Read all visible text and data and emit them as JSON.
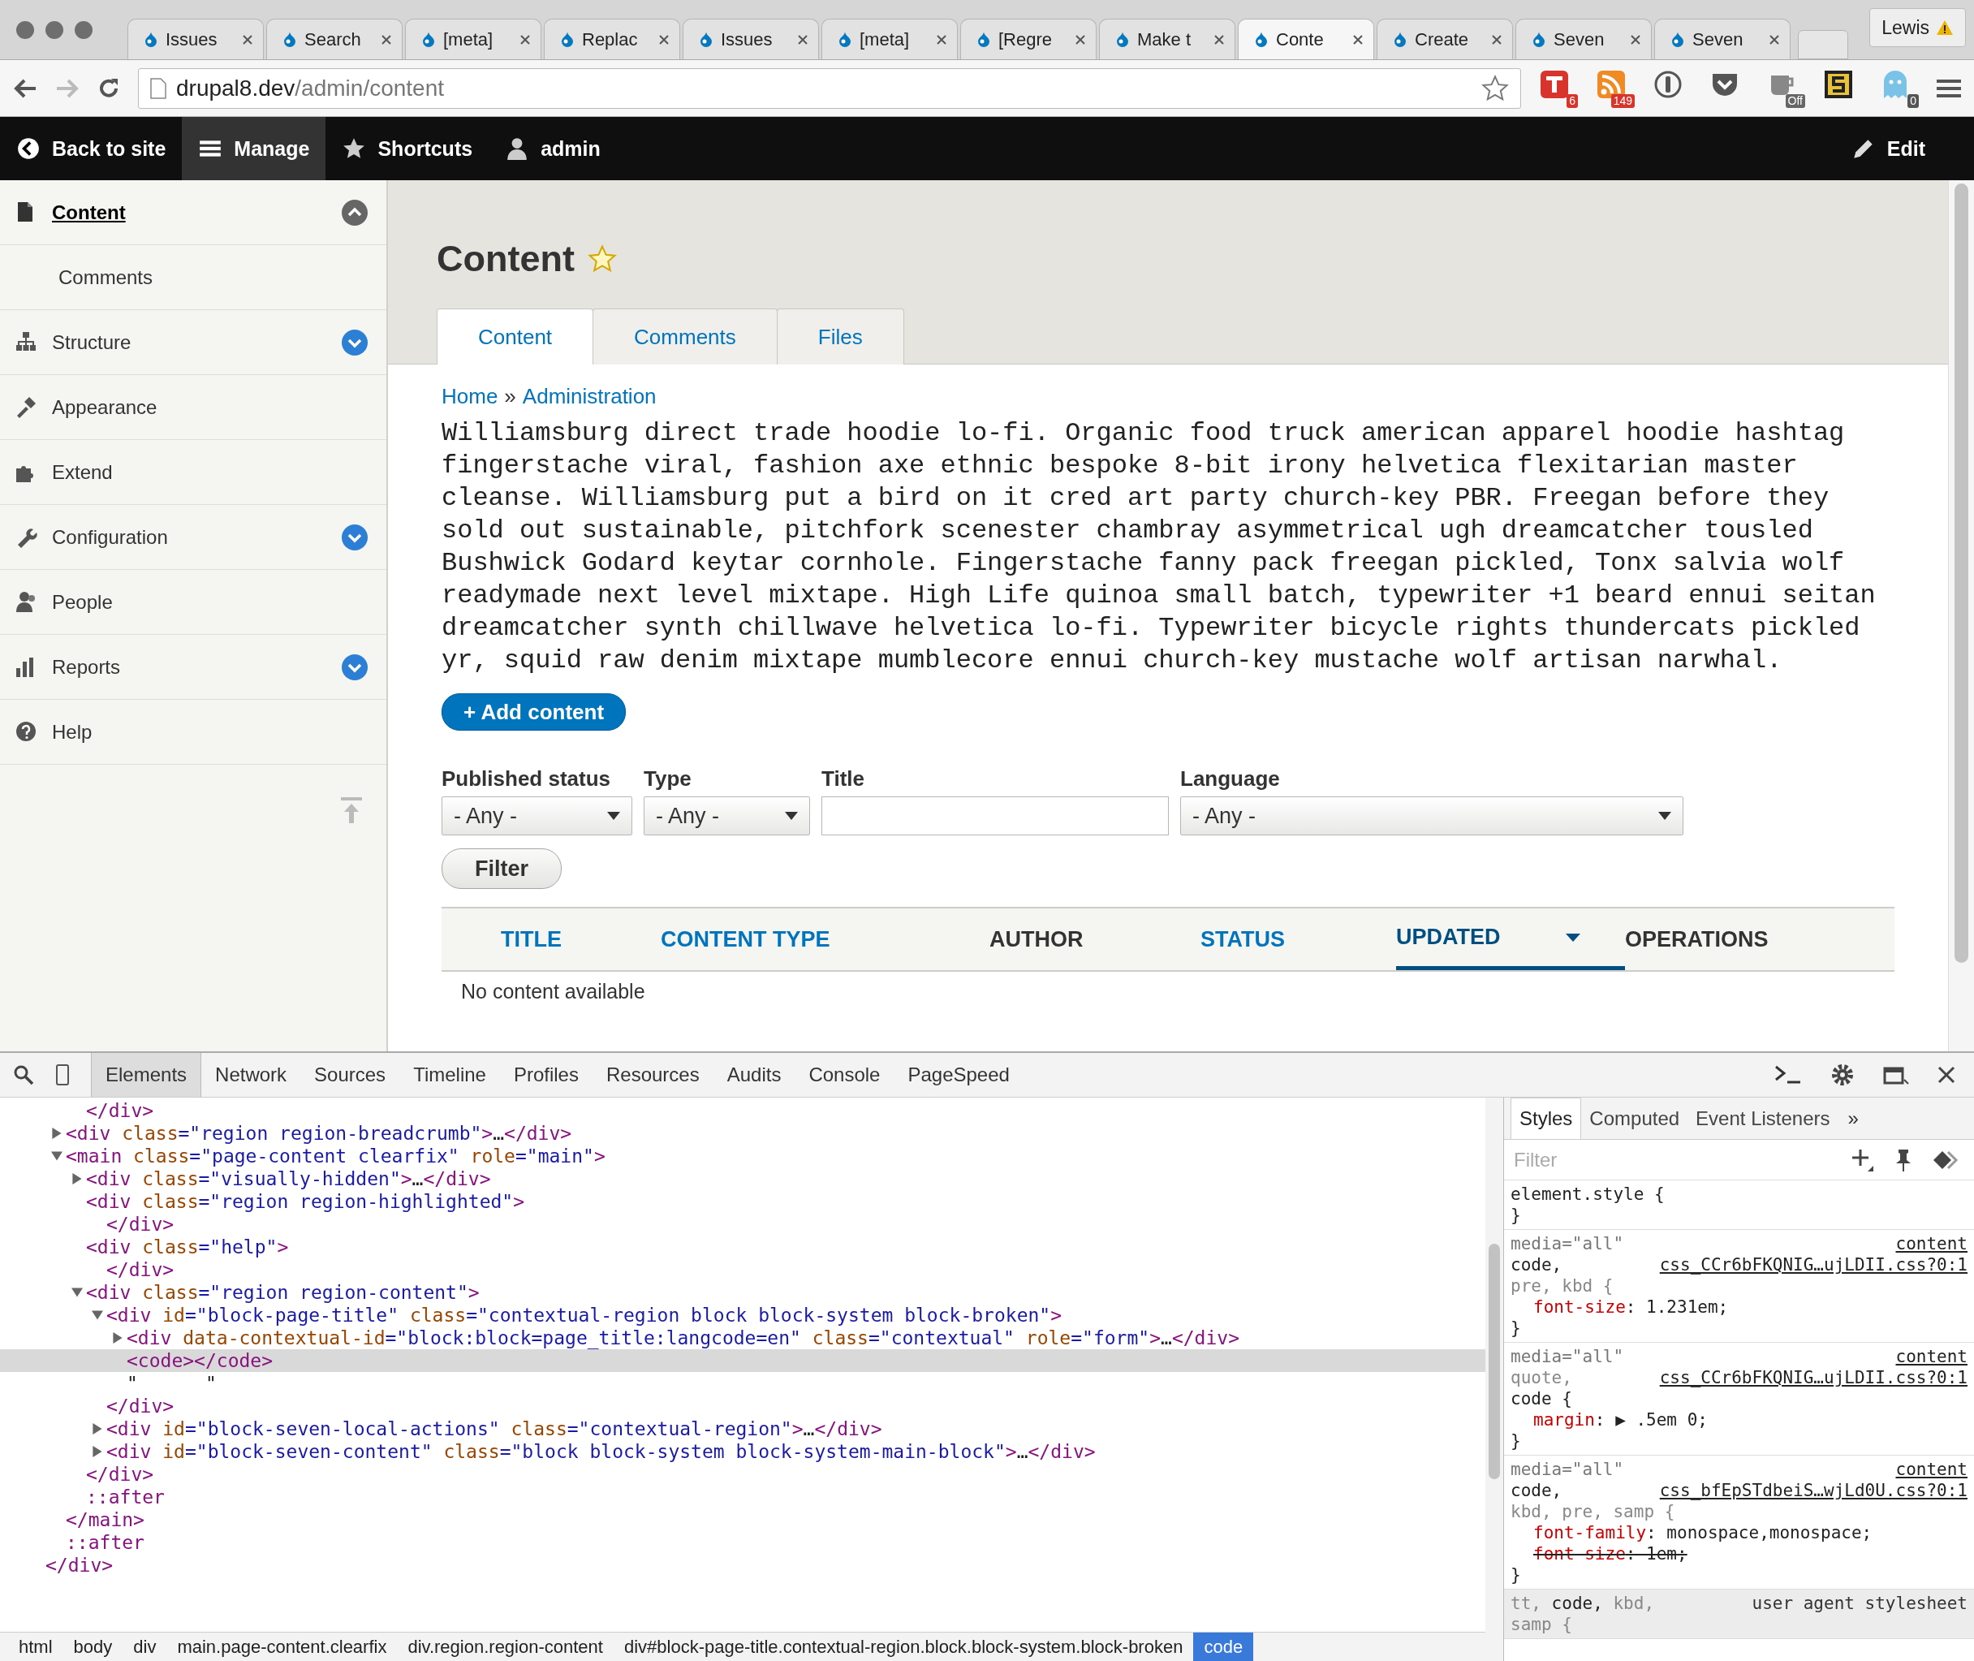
{
  "browser": {
    "tabs": [
      {
        "title": "Issues",
        "selected": false
      },
      {
        "title": "Search",
        "selected": false
      },
      {
        "title": "[meta]",
        "selected": false
      },
      {
        "title": "Replac",
        "selected": false
      },
      {
        "title": "Issues",
        "selected": false
      },
      {
        "title": "[meta]",
        "selected": false
      },
      {
        "title": "[Regre",
        "selected": false
      },
      {
        "title": "Make t",
        "selected": false
      },
      {
        "title": "Conte",
        "selected": true
      },
      {
        "title": "Create",
        "selected": false
      },
      {
        "title": "Seven",
        "selected": false
      },
      {
        "title": "Seven",
        "selected": false
      }
    ],
    "profile": "Lewis",
    "url": {
      "host": "drupal8.dev",
      "path": "/admin/content"
    },
    "extensions": [
      {
        "kind": "todo",
        "badge": "6"
      },
      {
        "kind": "rss",
        "badge": "149"
      },
      {
        "kind": "password"
      },
      {
        "kind": "pocket"
      },
      {
        "kind": "coffee",
        "badge": "Off"
      },
      {
        "kind": "stamp"
      },
      {
        "kind": "ghost",
        "badge": "0"
      }
    ]
  },
  "toolbar": {
    "items": [
      {
        "label": "Back to site",
        "selected": false
      },
      {
        "label": "Manage",
        "selected": true
      },
      {
        "label": "Shortcuts",
        "selected": false
      },
      {
        "label": "admin",
        "selected": false
      }
    ],
    "edit": "Edit"
  },
  "sidebar": {
    "items": [
      {
        "label": "Content",
        "selected": true,
        "expanded": true,
        "children": [
          {
            "label": "Comments",
            "selected": false
          }
        ]
      },
      {
        "label": "Structure",
        "selected": false,
        "expanded": false
      },
      {
        "label": "Appearance",
        "selected": false
      },
      {
        "label": "Extend",
        "selected": false
      },
      {
        "label": "Configuration",
        "selected": false,
        "expanded": false
      },
      {
        "label": "People",
        "selected": false
      },
      {
        "label": "Reports",
        "selected": false,
        "expanded": false
      },
      {
        "label": "Help",
        "selected": false
      }
    ]
  },
  "page": {
    "title": "Content",
    "tabs": [
      {
        "label": "Content",
        "selected": true
      },
      {
        "label": "Comments",
        "selected": false
      },
      {
        "label": "Files",
        "selected": false
      }
    ],
    "breadcrumb": [
      "Home",
      "Administration"
    ],
    "breadcrumb_separator": "»",
    "body": "Williamsburg direct trade hoodie lo-fi. Organic food truck american apparel hoodie hashtag fingerstache viral, fashion axe ethnic bespoke 8-bit irony helvetica flexitarian master cleanse. Williamsburg put a bird on it cred art party church-key PBR. Freegan before they sold out sustainable, pitchfork scenester chambray asymmetrical ugh dreamcatcher tousled Bushwick Godard keytar cornhole. Fingerstache fanny pack freegan pickled, Tonx salvia wolf readymade next level mixtape. High Life quinoa small batch, typewriter +1 beard ennui seitan dreamcatcher synth chillwave helvetica lo-fi. Typewriter bicycle rights thundercats pickled yr, squid raw denim mixtape mumblecore ennui church-key mustache wolf artisan narwhal.",
    "add_button": "+ Add content",
    "filters": [
      {
        "label": "Published status",
        "kind": "select",
        "value": "- Any -"
      },
      {
        "label": "Type",
        "kind": "select",
        "value": "- Any -"
      },
      {
        "label": "Title",
        "kind": "text"
      },
      {
        "label": "Language",
        "kind": "select",
        "value": "- Any -"
      }
    ],
    "filter_button": "Filter",
    "table": {
      "columns": [
        {
          "label": "TITLE",
          "sortable": true,
          "selected": false
        },
        {
          "label": "CONTENT TYPE",
          "sortable": true,
          "selected": false
        },
        {
          "label": "AUTHOR",
          "sortable": false,
          "selected": false
        },
        {
          "label": "STATUS",
          "sortable": true,
          "selected": false
        },
        {
          "label": "UPDATED",
          "sortable": true,
          "selected": true
        },
        {
          "label": "OPERATIONS",
          "sortable": false,
          "selected": false
        }
      ],
      "empty": "No content available"
    }
  },
  "devtools": {
    "tabs": [
      {
        "label": "Elements",
        "selected": true
      },
      {
        "label": "Network",
        "selected": false
      },
      {
        "label": "Sources",
        "selected": false
      },
      {
        "label": "Timeline",
        "selected": false
      },
      {
        "label": "Profiles",
        "selected": false
      },
      {
        "label": "Resources",
        "selected": false
      },
      {
        "label": "Audits",
        "selected": false
      },
      {
        "label": "Console",
        "selected": false
      },
      {
        "label": "PageSpeed",
        "selected": false
      }
    ],
    "tree": [
      {
        "children": [
          {
            "children": [
              {
                "line": "</div>",
                "selected": false
              }
            ]
          },
          {
            "line": "<div class=\"region region-breadcrumb\">…</div>",
            "expanded": false,
            "selected": false
          },
          {
            "line": "<main class=\"page-content clearfix\" role=\"main\">",
            "expanded": true,
            "selected": false,
            "children": [
              {
                "line": "<div class=\"visually-hidden\">…</div>",
                "expanded": false,
                "selected": false
              },
              {
                "line": "<div class=\"region region-highlighted\">",
                "selected": false,
                "children": [
                  {
                    "line": "</div>",
                    "selected": false
                  }
                ]
              },
              {
                "line": "<div class=\"help\">",
                "selected": false,
                "children": [
                  {
                    "line": "</div>",
                    "selected": false
                  }
                ]
              },
              {
                "line": "<div class=\"region region-content\">",
                "expanded": true,
                "selected": false,
                "children": [
                  {
                    "line": "<div id=\"block-page-title\" class=\"contextual-region block block-system block-broken\">",
                    "expanded": true,
                    "selected": false,
                    "children": [
                      {
                        "line": "<div data-contextual-id=\"block:block=page_title:langcode=en\" class=\"contextual\" role=\"form\">…</div>",
                        "expanded": false,
                        "selected": false
                      },
                      {
                        "line": "<code></code>",
                        "selected": true
                      },
                      {
                        "line": "\"      \"",
                        "selected": false
                      }
                    ]
                  },
                  {
                    "line": "</div>",
                    "selected": false
                  },
                  {
                    "line": "<div id=\"block-seven-local-actions\" class=\"contextual-region\">…</div>",
                    "expanded": false,
                    "selected": false
                  },
                  {
                    "line": "<div id=\"block-seven-content\" class=\"block block-system block-system-main-block\">…</div>",
                    "expanded": false,
                    "selected": false
                  }
                ]
              },
              {
                "line": "</div>",
                "selected": false
              },
              {
                "line": "::after",
                "selected": false
              }
            ]
          },
          {
            "line": "</main>",
            "selected": false
          },
          {
            "line": "::after",
            "selected": false
          }
        ]
      },
      {
        "line": "</div>",
        "selected": false
      }
    ],
    "path": [
      {
        "label": "html",
        "selected": false
      },
      {
        "label": "body",
        "selected": false
      },
      {
        "label": "div",
        "selected": false
      },
      {
        "label": "main.page-content.clearfix",
        "selected": false
      },
      {
        "label": "div.region.region-content",
        "selected": false
      },
      {
        "label": "div#block-page-title.contextual-region.block.block-system.block-broken",
        "selected": false
      },
      {
        "label": "code",
        "selected": true
      }
    ],
    "styles": {
      "tabs": [
        {
          "label": "Styles",
          "selected": true
        },
        {
          "label": "Computed",
          "selected": false
        },
        {
          "label": "Event Listeners",
          "selected": false
        }
      ],
      "more": "»",
      "filter_placeholder": "Filter",
      "rules": [
        {
          "user_agent": false,
          "selector": [
            [
              {
                "text": "element.style {",
                "matched": true
              }
            ]
          ],
          "close": "}"
        },
        {
          "user_agent": false,
          "media": "media=\"all\"",
          "source_label": "content",
          "source": "css_CCr6bFKQNIG…ujLDII.css?0:1",
          "selector": [
            [
              {
                "text": "code,",
                "matched": true
              }
            ],
            [
              {
                "text": "pre,",
                "matched": false
              },
              {
                "text": "kbd {",
                "matched": false
              }
            ]
          ],
          "props": [
            {
              "name": "font-size",
              "value": ": 1.231em;",
              "overridden": false
            }
          ],
          "close": "}"
        },
        {
          "user_agent": false,
          "media": "media=\"all\"",
          "source_label": "content",
          "source": "css_CCr6bFKQNIG…ujLDII.css?0:1",
          "selector": [
            [
              {
                "text": "quote,",
                "matched": false
              }
            ],
            [
              {
                "text": "code {",
                "matched": true
              }
            ]
          ],
          "props": [
            {
              "name": "margin",
              "value": ": ▶ .5em 0;",
              "overridden": false
            }
          ],
          "close": "}"
        },
        {
          "user_agent": false,
          "media": "media=\"all\"",
          "source_label": "content",
          "source": "css_bfEpSTdbeiS…wjLd0U.css?0:1",
          "selector": [
            [
              {
                "text": "code,",
                "matched": true
              }
            ],
            [
              {
                "text": "kbd,",
                "matched": false
              },
              {
                "text": "pre,",
                "matched": false
              },
              {
                "text": "samp {",
                "matched": false
              }
            ]
          ],
          "props": [
            {
              "name": "font-family",
              "value": ": monospace,monospace;",
              "overridden": false
            },
            {
              "name": "font-size",
              "value": ": 1em;",
              "overridden": true
            }
          ],
          "close": "}"
        },
        {
          "user_agent": true,
          "source": "user agent stylesheet",
          "selector": [
            [
              {
                "text": "tt,",
                "matched": false
              },
              {
                "text": "code,",
                "matched": true
              },
              {
                "text": "kbd,",
                "matched": false
              }
            ],
            [
              {
                "text": "samp {",
                "matched": false
              }
            ]
          ]
        }
      ]
    }
  }
}
